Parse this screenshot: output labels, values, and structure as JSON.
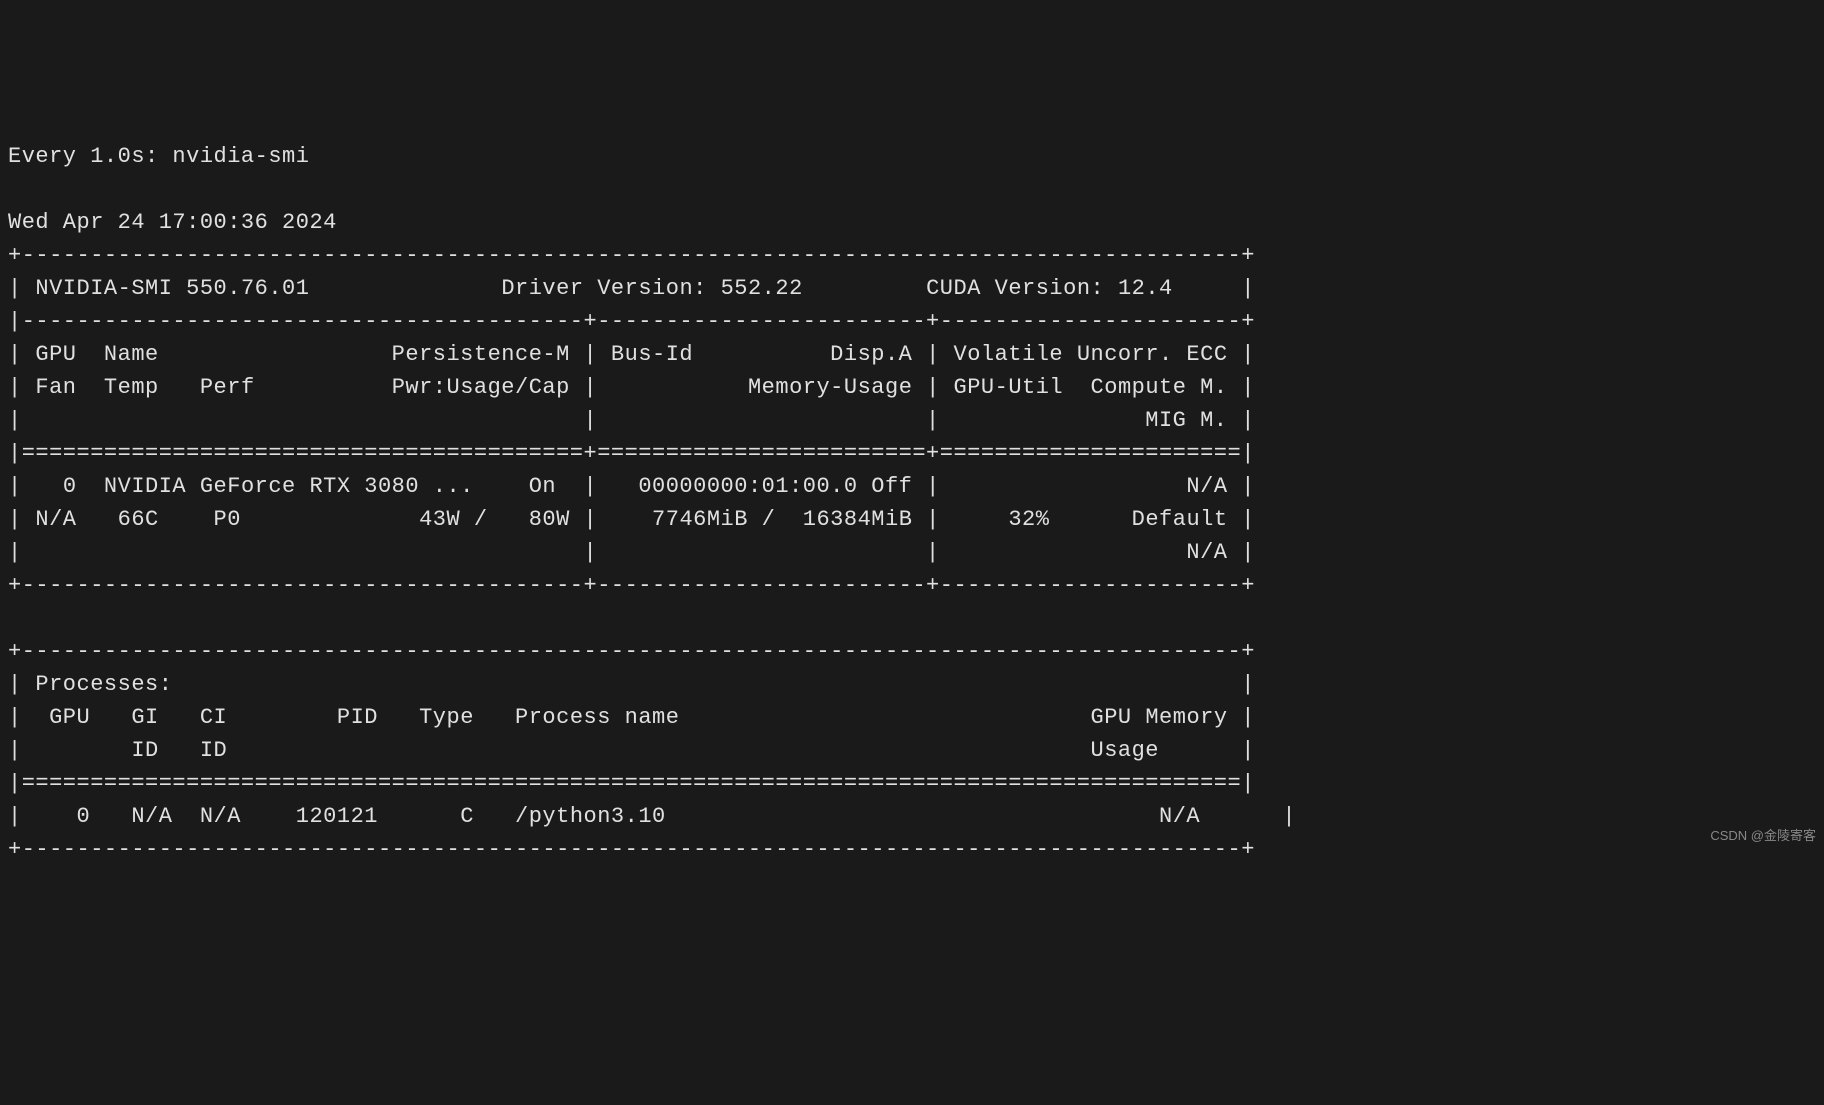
{
  "watch": {
    "prefix": "Every 1.0s: nvidia-smi"
  },
  "timestamp": "Wed Apr 24 17:00:36 2024",
  "header": {
    "smi_label": "NVIDIA-SMI",
    "smi_version": "550.76.01",
    "driver_label": "Driver Version:",
    "driver_version": "552.22",
    "cuda_label": "CUDA Version:",
    "cuda_version": "12.4"
  },
  "column_headers": {
    "row1": {
      "gpu": "GPU",
      "name": "Name",
      "persistence": "Persistence-M",
      "busid": "Bus-Id",
      "disp": "Disp.A",
      "volatile": "Volatile Uncorr. ECC"
    },
    "row2": {
      "fan": "Fan",
      "temp": "Temp",
      "perf": "Perf",
      "pwr": "Pwr:Usage/Cap",
      "memusage": "Memory-Usage",
      "gpuutil": "GPU-Util",
      "compute": "Compute M."
    },
    "row3": {
      "mig": "MIG M."
    }
  },
  "gpu0": {
    "index": "0",
    "name": "NVIDIA GeForce RTX 3080 ...",
    "persistence": "On",
    "busid": "00000000:01:00.0",
    "disp": "Off",
    "ecc": "N/A",
    "fan": "N/A",
    "temp": "66C",
    "perf": "P0",
    "pwr_usage": "43W",
    "pwr_cap": "80W",
    "mem_used": "7746MiB",
    "mem_total": "16384MiB",
    "util": "32%",
    "compute": "Default",
    "mig": "N/A"
  },
  "processes": {
    "title": "Processes:",
    "headers": {
      "gpu": "GPU",
      "gi": "GI",
      "ci": "CI",
      "pid": "PID",
      "type": "Type",
      "name": "Process name",
      "mem": "GPU Memory"
    },
    "headers2": {
      "id1": "ID",
      "id2": "ID",
      "usage": "Usage"
    },
    "rows": [
      {
        "gpu": "0",
        "gi": "N/A",
        "ci": "N/A",
        "pid": "120121",
        "type": "C",
        "name": "/python3.10",
        "mem": "N/A"
      }
    ]
  },
  "watermark": "CSDN @金陵寄客"
}
